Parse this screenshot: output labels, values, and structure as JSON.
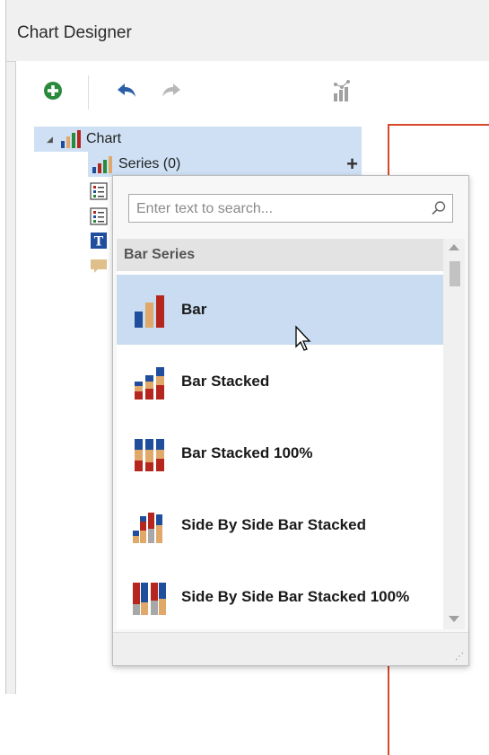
{
  "window": {
    "title": "Chart Designer"
  },
  "toolbar": {
    "add_icon": "add-circle-icon",
    "undo_icon": "undo-arrow-icon",
    "redo_icon": "redo-arrow-icon",
    "chart_wizard_icon": "chart-wizard-icon"
  },
  "tree": {
    "items": [
      {
        "label": "Chart",
        "icon": "bar-chart-icon"
      },
      {
        "label": "Series (0)",
        "icon": "series-icon"
      }
    ]
  },
  "popup": {
    "search_placeholder": "Enter text to search...",
    "group_header": "Bar Series",
    "items": [
      {
        "label": "Bar"
      },
      {
        "label": "Bar Stacked"
      },
      {
        "label": "Bar Stacked 100%"
      },
      {
        "label": "Side By Side Bar Stacked"
      },
      {
        "label": "Side By Side Bar Stacked 100%"
      }
    ]
  },
  "colors": {
    "blue": "#1f4e9c",
    "tan": "#e0a96a",
    "red": "#b5261e",
    "gray": "#a8a8a8",
    "selection": "#c9dcf1",
    "add_green": "#2a8a3c"
  }
}
